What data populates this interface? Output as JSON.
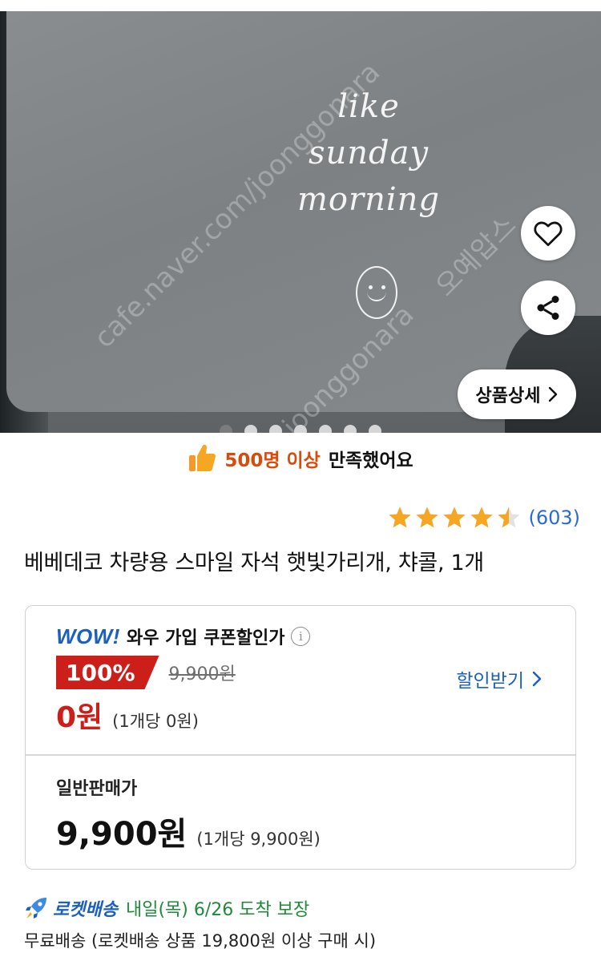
{
  "hero": {
    "cloth_text": [
      "like",
      "sunday",
      "morning"
    ],
    "watermarks": [
      "cafe.naver.com/joonggonara",
      "오예압스",
      "joonggonara"
    ],
    "detail_button_label": "상품상세",
    "dots_count": 7,
    "active_dot": 0
  },
  "satisfaction": {
    "highlight": "500명 이상",
    "rest": "만족했어요"
  },
  "rating": {
    "stars": 4.5,
    "count": "(603)"
  },
  "product": {
    "title": "베베데코 차량용 스마일 자석 햇빛가리개, 챠콜, 1개"
  },
  "wow": {
    "logo": "WOW!",
    "label": "와우 가입 쿠폰할인가",
    "discount_percent": "100%",
    "original_price": "9,900원",
    "coupon_price": "0원",
    "coupon_unit_price": "(1개당 0원)",
    "get_discount_label": "할인받기"
  },
  "normal": {
    "label": "일반판매가",
    "price": "9,900원",
    "unit_price": "(1개당 9,900원)"
  },
  "delivery": {
    "rocket_label": "로켓배송",
    "arrival": "내일(목) 6/26 도착 보장",
    "free_shipping": "무료배송 (로켓배송 상품 19,800원 이상 구매 시)"
  },
  "colors": {
    "accent_blue": "#1b5fbf",
    "sale_red": "#cc1f1a",
    "satisfy_orange": "#d94a0b",
    "star_gold": "#f5a623",
    "arrival_green": "#1e8a3a"
  },
  "icons": [
    "heart-icon",
    "share-icon",
    "chevron-right-icon",
    "thumbs-up-icon",
    "info-icon",
    "star-icon",
    "rocket-icon"
  ]
}
